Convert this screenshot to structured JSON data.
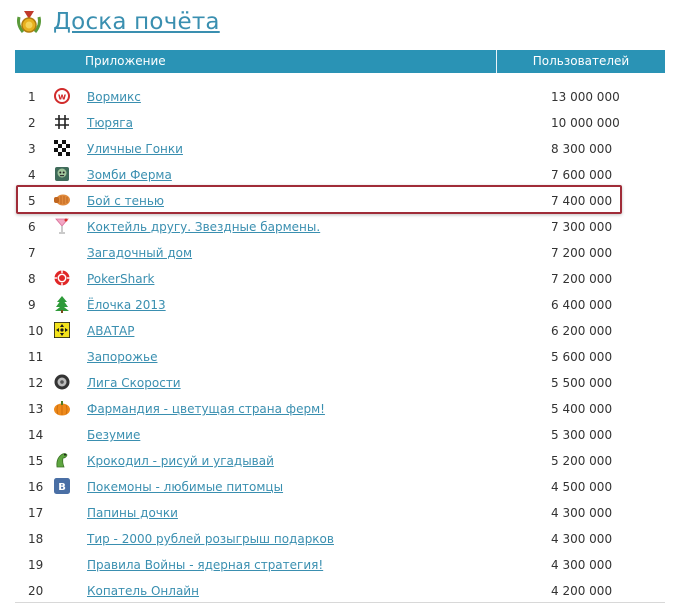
{
  "page": {
    "title": "Доска почёта"
  },
  "table": {
    "col_app": "Приложение",
    "col_users": "Пользователей",
    "rows": [
      {
        "rank": "1",
        "icon": "wormix-w-icon",
        "name": "Вормикс",
        "users": "13 000 000"
      },
      {
        "rank": "2",
        "icon": "hash-icon",
        "name": "Тюряга",
        "users": "10 000 000"
      },
      {
        "rank": "3",
        "icon": "checkered-flag-icon",
        "name": "Уличные Гонки",
        "users": "8 300 000"
      },
      {
        "rank": "4",
        "icon": "zombie-icon",
        "name": "Зомби Ферма",
        "users": "7 600 000"
      },
      {
        "rank": "5",
        "icon": "fist-icon",
        "name": "Бой с тенью",
        "users": "7 400 000"
      },
      {
        "rank": "6",
        "icon": "cocktail-icon",
        "name": "Коктейль другу. Звездные бармены.",
        "users": "7 300 000"
      },
      {
        "rank": "7",
        "icon": "",
        "name": "Загадочный дом",
        "users": "7 200 000"
      },
      {
        "rank": "8",
        "icon": "poker-chip-icon",
        "name": "PokerShark",
        "users": "7 200 000"
      },
      {
        "rank": "9",
        "icon": "christmas-tree-icon",
        "name": "Ёлочка 2013",
        "users": "6 400 000"
      },
      {
        "rank": "10",
        "icon": "avatar-arrows-icon",
        "name": "АВАТАР",
        "users": "6 200 000"
      },
      {
        "rank": "11",
        "icon": "",
        "name": "Запорожье",
        "users": "5 600 000"
      },
      {
        "rank": "12",
        "icon": "tire-icon",
        "name": "Лига Скорости",
        "users": "5 500 000"
      },
      {
        "rank": "13",
        "icon": "pumpkin-icon",
        "name": "Фармандия - цветущая страна ферм!",
        "users": "5 400 000"
      },
      {
        "rank": "14",
        "icon": "",
        "name": "Безумие",
        "users": "5 300 000"
      },
      {
        "rank": "15",
        "icon": "crocodile-icon",
        "name": "Крокодил - рисуй и угадывай",
        "users": "5 200 000"
      },
      {
        "rank": "16",
        "icon": "vk-icon",
        "name": "Покемоны - любимые питомцы",
        "users": "4 500 000"
      },
      {
        "rank": "17",
        "icon": "",
        "name": "Папины дочки",
        "users": "4 300 000"
      },
      {
        "rank": "18",
        "icon": "",
        "name": "Тир - 2000 рублей розыгрыш подарков",
        "users": "4 300 000"
      },
      {
        "rank": "19",
        "icon": "",
        "name": "Правила Войны - ядерная стратегия!",
        "users": "4 300 000"
      },
      {
        "rank": "20",
        "icon": "",
        "name": "Копатель Онлайн",
        "users": "4 200 000"
      }
    ]
  },
  "colors": {
    "accent": "#2a93b5",
    "link": "#3a8fb0",
    "highlight_border": "#a02c38"
  }
}
